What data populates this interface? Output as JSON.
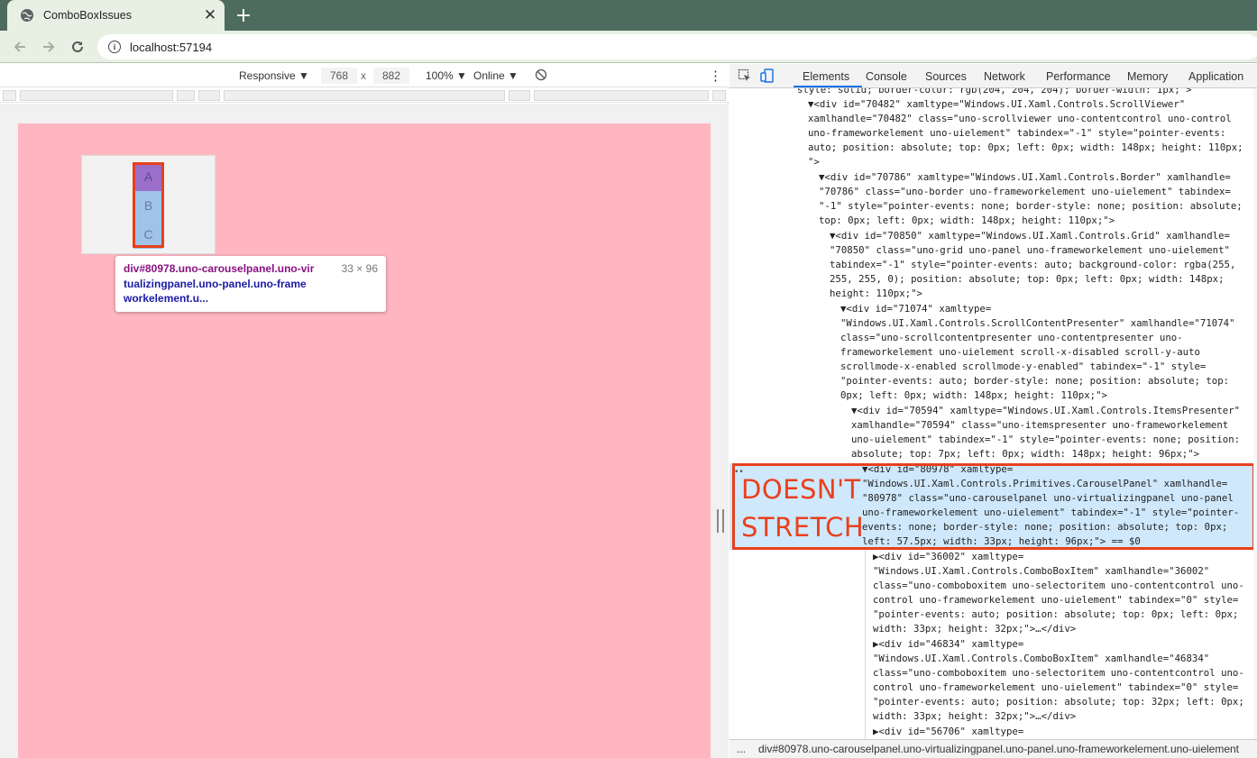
{
  "browser": {
    "tab_title": "ComboBoxIssues",
    "url": "localhost:57194",
    "tab_close_glyph": "✕",
    "new_tab_glyph": "+"
  },
  "device_toolbar": {
    "device": "Responsive ▼",
    "width": "768",
    "times": "x",
    "height": "882",
    "zoom": "100% ▼",
    "network": "Online ▼",
    "more": "⋮"
  },
  "page": {
    "items": [
      "A",
      "B",
      "C"
    ],
    "tooltip_selector": "div#80978.uno-carouselpanel.uno-vir",
    "tooltip_selector_2": "tualizingpanel.uno-panel.uno-frame",
    "tooltip_selector_3": "workelement.u...",
    "tooltip_size": "33 × 96",
    "colors": {
      "background": "#ffb6c1",
      "popup": "#f2f2f2",
      "highlight": "#e8401c",
      "item_selected": "#9b6fc9",
      "item": "#a0c4e8"
    }
  },
  "devtools": {
    "tabs": [
      "Elements",
      "Console",
      "Sources",
      "Network",
      "Performance",
      "Memory",
      "Application"
    ],
    "active_tab": "Elements",
    "annotation_line1": "DOESN'T",
    "annotation_line2": "STRETCH",
    "breadcrumb_ellipsis": "...",
    "breadcrumb": "div#80978.uno-carouselpanel.uno-virtualizingpanel.uno-panel.uno-frameworkelement.uno-uielement",
    "dom_lines": [
      "style: solid; border-color: rgb(204, 204, 204); border-width: 1px;\">",
      "▼<div id=\"70482\" xamltype=\"Windows.UI.Xaml.Controls.ScrollViewer\"",
      "xamlhandle=\"70482\" class=\"uno-scrollviewer uno-contentcontrol uno-control",
      "uno-frameworkelement uno-uielement\" tabindex=\"-1\" style=\"pointer-events:",
      "auto; position: absolute; top: 0px; left: 0px; width: 148px; height: 110px;",
      "\">",
      "▼<div id=\"70786\" xamltype=\"Windows.UI.Xaml.Controls.Border\" xamlhandle=",
      "\"70786\" class=\"uno-border uno-frameworkelement uno-uielement\" tabindex=",
      "\"-1\" style=\"pointer-events: none; border-style: none; position: absolute;",
      "top: 0px; left: 0px; width: 148px; height: 110px;\">",
      "▼<div id=\"70850\" xamltype=\"Windows.UI.Xaml.Controls.Grid\" xamlhandle=",
      "\"70850\" class=\"uno-grid uno-panel uno-frameworkelement uno-uielement\"",
      "tabindex=\"-1\" style=\"pointer-events: auto; background-color: rgba(255,",
      "255, 255, 0); position: absolute; top: 0px; left: 0px; width: 148px;",
      "height: 110px;\">",
      "▼<div id=\"71074\" xamltype=",
      "\"Windows.UI.Xaml.Controls.ScrollContentPresenter\" xamlhandle=\"71074\"",
      "class=\"uno-scrollcontentpresenter uno-contentpresenter uno-",
      "frameworkelement uno-uielement scroll-x-disabled scroll-y-auto",
      "scrollmode-x-enabled scrollmode-y-enabled\" tabindex=\"-1\" style=",
      "\"pointer-events: auto; border-style: none; position: absolute; top:",
      "0px; left: 0px; width: 148px; height: 110px;\">",
      "▼<div id=\"70594\" xamltype=\"Windows.UI.Xaml.Controls.ItemsPresenter\"",
      "xamlhandle=\"70594\" class=\"uno-itemspresenter uno-frameworkelement",
      "uno-uielement\" tabindex=\"-1\" style=\"pointer-events: none; position:",
      "absolute; top: 7px; left: 0px; width: 148px; height: 96px;\">",
      "▼<div id=\"80978\" xamltype=",
      "\"Windows.UI.Xaml.Controls.Primitives.CarouselPanel\" xamlhandle=",
      "\"80978\" class=\"uno-carouselpanel uno-virtualizingpanel uno-panel",
      "uno-frameworkelement uno-uielement\" tabindex=\"-1\" style=\"pointer-",
      "events: none; border-style: none; position: absolute; top: 0px;",
      "left: 57.5px; width: 33px; height: 96px;\"> == $0",
      "▶<div id=\"36002\" xamltype=",
      "\"Windows.UI.Xaml.Controls.ComboBoxItem\" xamlhandle=\"36002\"",
      "class=\"uno-comboboxitem uno-selectoritem uno-contentcontrol uno-",
      "control uno-frameworkelement uno-uielement\" tabindex=\"0\" style=",
      "\"pointer-events: auto; position: absolute; top: 0px; left: 0px;",
      "width: 33px; height: 32px;\">…</div>",
      "▶<div id=\"46834\" xamltype=",
      "\"Windows.UI.Xaml.Controls.ComboBoxItem\" xamlhandle=\"46834\"",
      "class=\"uno-comboboxitem uno-selectoritem uno-contentcontrol uno-",
      "control uno-frameworkelement uno-uielement\" tabindex=\"0\" style=",
      "\"pointer-events: auto; position: absolute; top: 32px; left: 0px;",
      "width: 33px; height: 32px;\">…</div>",
      "▶<div id=\"56706\" xamltype="
    ]
  }
}
